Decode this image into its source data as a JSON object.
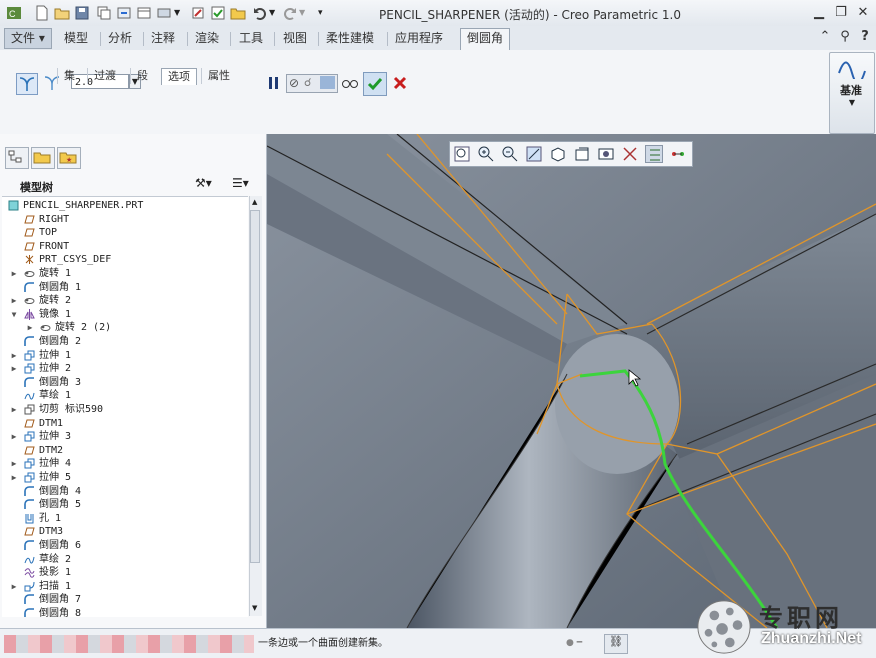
{
  "window": {
    "title": "PENCIL_SHARPENER (活动的) - Creo Parametric 1.0",
    "controls": [
      "minimize",
      "restore",
      "close"
    ]
  },
  "quick_access": [
    "new-icon",
    "open-icon",
    "save-icon",
    "regenerate-icon",
    "undo-icon",
    "redo-icon"
  ],
  "tabs": [
    {
      "label": "文件",
      "type": "file"
    },
    {
      "label": "模型"
    },
    {
      "label": "分析"
    },
    {
      "label": "注释"
    },
    {
      "label": "渲染"
    },
    {
      "label": "工具"
    },
    {
      "label": "视图"
    },
    {
      "label": "柔性建模"
    },
    {
      "label": "应用程序"
    },
    {
      "label": "倒圆角",
      "active": true
    }
  ],
  "ribbon": {
    "radius_value": "2.0",
    "subtabs": [
      "集",
      "过渡",
      "段",
      "选项",
      "属性"
    ],
    "active_subtab": "选项",
    "datum_label": "基准"
  },
  "model_tree": {
    "title": "模型树",
    "items": [
      {
        "label": "PENCIL_SHARPENER.PRT",
        "icon": "part-icon",
        "indent": 0,
        "expand": ""
      },
      {
        "label": "RIGHT",
        "icon": "datum-plane-icon",
        "indent": 1,
        "expand": ""
      },
      {
        "label": "TOP",
        "icon": "datum-plane-icon",
        "indent": 1,
        "expand": ""
      },
      {
        "label": "FRONT",
        "icon": "datum-plane-icon",
        "indent": 1,
        "expand": ""
      },
      {
        "label": "PRT_CSYS_DEF",
        "icon": "csys-icon",
        "indent": 1,
        "expand": ""
      },
      {
        "label": "旋转 1",
        "icon": "revolve-icon",
        "indent": 1,
        "expand": "▶"
      },
      {
        "label": "倒圆角 1",
        "icon": "round-icon",
        "indent": 1,
        "expand": ""
      },
      {
        "label": "旋转 2",
        "icon": "revolve-icon",
        "indent": 1,
        "expand": "▶"
      },
      {
        "label": "镜像 1",
        "icon": "mirror-icon",
        "indent": 1,
        "expand": "▼"
      },
      {
        "label": "旋转 2 (2)",
        "icon": "revolve-icon",
        "indent": 2,
        "expand": "▶"
      },
      {
        "label": "倒圆角 2",
        "icon": "round-icon",
        "indent": 1,
        "expand": ""
      },
      {
        "label": "拉伸 1",
        "icon": "extrude-icon",
        "indent": 1,
        "expand": "▶"
      },
      {
        "label": "拉伸 2",
        "icon": "extrude-icon",
        "indent": 1,
        "expand": "▶"
      },
      {
        "label": "倒圆角 3",
        "icon": "round-icon",
        "indent": 1,
        "expand": ""
      },
      {
        "label": "草绘 1",
        "icon": "sketch-icon",
        "indent": 1,
        "expand": ""
      },
      {
        "label": "切剪 标识590",
        "icon": "cut-icon",
        "indent": 1,
        "expand": "▶"
      },
      {
        "label": "DTM1",
        "icon": "datum-plane-icon",
        "indent": 1,
        "expand": ""
      },
      {
        "label": "拉伸 3",
        "icon": "extrude-icon",
        "indent": 1,
        "expand": "▶"
      },
      {
        "label": "DTM2",
        "icon": "datum-plane-icon",
        "indent": 1,
        "expand": ""
      },
      {
        "label": "拉伸 4",
        "icon": "extrude-icon",
        "indent": 1,
        "expand": "▶"
      },
      {
        "label": "拉伸 5",
        "icon": "extrude-icon",
        "indent": 1,
        "expand": "▶"
      },
      {
        "label": "倒圆角 4",
        "icon": "round-icon",
        "indent": 1,
        "expand": ""
      },
      {
        "label": "倒圆角 5",
        "icon": "round-icon",
        "indent": 1,
        "expand": ""
      },
      {
        "label": "孔 1",
        "icon": "hole-icon",
        "indent": 1,
        "expand": ""
      },
      {
        "label": "DTM3",
        "icon": "datum-plane-icon",
        "indent": 1,
        "expand": ""
      },
      {
        "label": "倒圆角 6",
        "icon": "round-icon",
        "indent": 1,
        "expand": ""
      },
      {
        "label": "草绘 2",
        "icon": "sketch-icon",
        "indent": 1,
        "expand": ""
      },
      {
        "label": "投影 1",
        "icon": "project-icon",
        "indent": 1,
        "expand": ""
      },
      {
        "label": "扫描 1",
        "icon": "sweep-icon",
        "indent": 1,
        "expand": "▶"
      },
      {
        "label": "倒圆角 7",
        "icon": "round-icon",
        "indent": 1,
        "expand": ""
      },
      {
        "label": "倒圆角 8",
        "icon": "round-icon",
        "indent": 1,
        "expand": ""
      }
    ]
  },
  "status": {
    "message": "一条边或一个曲面创建新集。"
  },
  "watermark": {
    "chinese": "专职网",
    "latin": "Zhuanzhi.Net"
  },
  "colors": {
    "accent_orange": "#e0952a",
    "selected_edge_green": "#3cd43c",
    "model_gray": "#6e7988"
  }
}
